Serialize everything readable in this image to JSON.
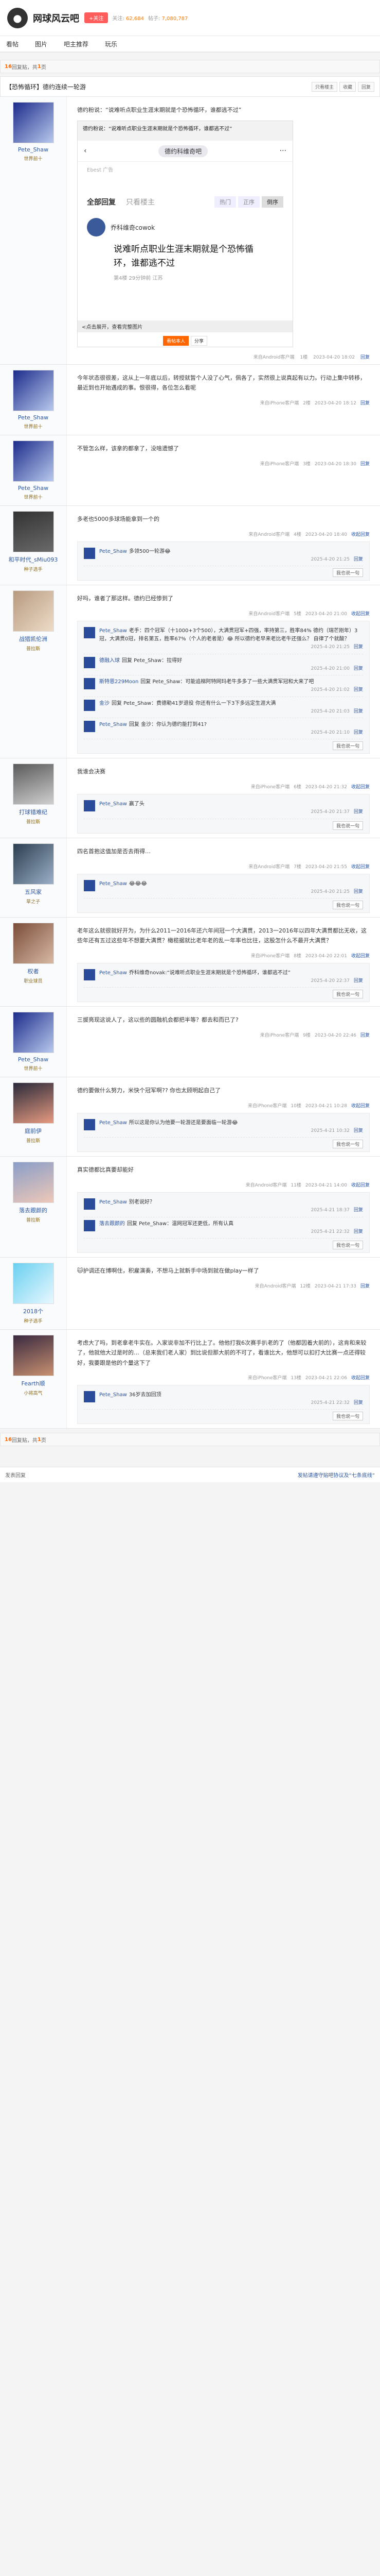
{
  "forum": {
    "name": "网球风云吧",
    "follow": "+关注",
    "members_label": "关注:",
    "members": "62,684",
    "posts_label": "帖子:",
    "posts": "7,080,787"
  },
  "nav": [
    "看帖",
    "图片",
    "吧主推荐",
    "玩乐"
  ],
  "thread": {
    "title": "【恐怖循环】德约连续一轮游",
    "buttons": [
      "只看楼主",
      "收藏",
      "回复"
    ]
  },
  "pager": {
    "count": "16",
    "unit": "回复贴，共",
    "pages": "1",
    "pages_unit": "页"
  },
  "op": {
    "user": "Pete_Shaw",
    "level": "世界前十",
    "content": "德约粉说：“说难听点职业生涯末期就是个恐怖循环，谁都逃不过”",
    "shot": {
      "ann": "德约粉说：“说难听点职业生涯末期就是个恐怖循环，谁都逃不过”",
      "bar": "德约科维奇吧",
      "ad": "Ebest 广告",
      "tab_all": "全部回复",
      "tab_op": "只看楼主",
      "sort": [
        "热门",
        "正序",
        "倒序"
      ],
      "user": "乔科维奇cowok",
      "body": "说难听点职业生涯末期就是个恐怖循环，谁都逃不过",
      "meta": "第4楼  29分钟前  江苏",
      "note": "<点击展开，查看完整图片",
      "pub": [
        "看帖本人",
        "分享"
      ]
    },
    "tail": {
      "from": "来自Android客户端",
      "floor": "1楼",
      "time": "2023-04-20 18:02",
      "reply": "回复"
    }
  },
  "posts": [
    {
      "user": "Pete_Shaw",
      "level": "世界前十",
      "av": "a1",
      "content": "今年状态很很差，这从上一年底以后，转授就暂个人没了心气，佩各了，实然很上说真起有以力。行动上集中转移，最近到也开始遇成的事。恨很得，各位怎么看呢",
      "tail": {
        "from": "来自iPhone客户端",
        "floor": "2楼",
        "time": "2023-04-20 18:12",
        "reply": "回复"
      },
      "comments": []
    },
    {
      "user": "Pete_Shaw",
      "level": "世界前十",
      "av": "a1",
      "content": "不管怎么样，该拿的都拿了，没啥遗憾了",
      "tail": {
        "from": "来自iPhone客户端",
        "floor": "3楼",
        "time": "2023-04-20 18:30",
        "reply": "回复"
      },
      "comments": []
    },
    {
      "user": "和平时代_sMiu093",
      "level": "种子选手",
      "av": "a2",
      "content": "多老也5000多球场能拿到一个的",
      "tail": {
        "from": "来自Android客户端",
        "floor": "4楼",
        "time": "2023-04-20 18:40",
        "reply": "收起回复"
      },
      "comments": [
        {
          "user": "Pete_Shaw",
          "text": "多领500一轮游😂",
          "time": "2025-4-20 21:25",
          "reply": "回复"
        }
      ]
    },
    {
      "user": "战猎凯伦洲",
      "level": "普拉斯",
      "av": "a3",
      "content": "好吗，谁者了那这样。德约已经惨到了",
      "tail": {
        "from": "来自Android客户端",
        "floor": "5楼",
        "time": "2023-04-20 21:00",
        "reply": "收起回复"
      },
      "comments": [
        {
          "user": "Pete_Shaw",
          "text": "老手：四个冠军（十1000+3个500），大满贯冠军+四强，率持第三，胜率84%  德约（瑞芒刚年）3冠，大满贯0冠，排名第五，胜率67%（个人的老者是）😂 所以德约老早来老比老牛还强么？ 自律了个就酸？",
          "time": "2025-4-20 21:25",
          "reply": "回复"
        },
        {
          "user": "德融入球",
          "text": "回复 Pete_Shaw：拉得好",
          "time": "2025-4-20 21:00",
          "reply": "回复"
        },
        {
          "user": "斯特恩229Moon",
          "text": "回复 Pete_Shaw：可能追梯阿特网玛老牛多多了一些大满贯军冠和大来了吧",
          "time": "2025-4-20 21:02",
          "reply": "回复"
        },
        {
          "user": "金沙",
          "text": "回复 Pete_Shaw：费德勒41岁退役  你还有什么一下3下多远定生涯大满",
          "time": "2025-4-20 21:03",
          "reply": "回复"
        },
        {
          "user": "Pete_Shaw",
          "text": "回复 金沙：你认为德约能打到41?",
          "time": "2025-4-20 21:10",
          "reply": "回复"
        }
      ]
    },
    {
      "user": "打球错难纪",
      "level": "普拉斯",
      "av": "a4",
      "content": "我谁会决赛",
      "tail": {
        "from": "来自iPhone客户端",
        "floor": "6楼",
        "time": "2023-04-20 21:32",
        "reply": "收起回复"
      },
      "comments": [
        {
          "user": "Pete_Shaw",
          "text": "赢了头",
          "time": "2025-4-20 21:37",
          "reply": "回复"
        }
      ]
    },
    {
      "user": "五风家",
      "level": "草之子",
      "av": "a5",
      "content": "四名首抱这值加是否去雨得…",
      "tail": {
        "from": "来自Android客户端",
        "floor": "7楼",
        "time": "2023-04-20 21:55",
        "reply": "收起回复"
      },
      "comments": [
        {
          "user": "Pete_Shaw",
          "text": "😂😂😂",
          "time": "2025-4-20 21:25",
          "reply": "回复"
        }
      ]
    },
    {
      "user": "权者",
      "level": "职业球员",
      "av": "a6",
      "content": "老年这么就很就好开为，为什么2011一2016年还六年间冠一个大满贯，2013一2016年以四年大满贯都比无收，这些年还有五过这些年不想要大满贯？橄榄据就比老年老的乱一年率也比往，这股怎什么不最开大满贯？",
      "tail": {
        "from": "来自iPhone客户端",
        "floor": "8楼",
        "time": "2023-04-20 22:01",
        "reply": "收起回复"
      },
      "comments": [
        {
          "user": "Pete_Shaw",
          "text": "乔科维奇novak:“说难听点职业生涯末期就是个恐怖循环，谁都逃不过”",
          "time": "2025-4-20 22:37",
          "reply": "回复"
        }
      ]
    },
    {
      "user": "Pete_Shaw",
      "level": "世界前十",
      "av": "a1",
      "content": "三拔亮现这说人了，这以些的圆融机会都把半等？都去和而已了?",
      "tail": {
        "from": "来自iPhone客户端",
        "floor": "9楼",
        "time": "2023-04-20 22:46",
        "reply": "回复"
      },
      "comments": []
    },
    {
      "user": "庭前伊",
      "level": "普拉斯",
      "av": "a7",
      "content": "德约要做什么努力，米快个冠军啊?? 你也太顾明起自己了",
      "tail": {
        "from": "来自iPhone客户端",
        "floor": "10楼",
        "time": "2023-04-21 10:28",
        "reply": "收起回复"
      },
      "comments": [
        {
          "user": "Pete_Shaw",
          "text": "所以这是你认为他要一轮游还是要面临一轮游😂",
          "time": "2025-4-21 10:32",
          "reply": "回复"
        }
      ]
    },
    {
      "user": "落去跟颜的",
      "level": "普拉斯",
      "av": "a8",
      "content": "真实德都比真要却能好",
      "tail": {
        "from": "来自Android客户端",
        "floor": "11楼",
        "time": "2023-04-21 14:00",
        "reply": "收起回复"
      },
      "comments": [
        {
          "user": "Pete_Shaw",
          "text": "别老说好？",
          "time": "2025-4-21 18:37",
          "reply": "回复"
        },
        {
          "user": "落去跟颜的",
          "text": "回复 Pete_Shaw：温网冠军还更低，所有认真",
          "time": "2025-4-21 22:32",
          "reply": "回复"
        }
      ]
    },
    {
      "user": "2018个",
      "level": "种子选手",
      "av": "a9",
      "content": "🐱护调还在博啊住，积雇演奏，不想马上就新手中场到就在做play一样了",
      "tail": {
        "from": "来自Android客户端",
        "floor": "12楼",
        "time": "2023-04-21 17:33",
        "reply": "回复"
      },
      "comments": []
    },
    {
      "user": "Fearth顺",
      "level": "小将高气",
      "av": "a10",
      "content": "考虑大了吗，到老拿老牛实在。入家说非加不行比上了。他他打我6次赛手扒老的了（他都因着大前的），这肯和来较了，他就他大过是时的…（总来我们老人家）到比说但那大前的不可了，看谁比大，他想可以扣打大比赛一点还得较好，我要跟是他的个量这下了",
      "tail": {
        "from": "来自iPhone客户端",
        "floor": "13楼",
        "time": "2023-04-21 22:06",
        "reply": "收起回复"
      },
      "comments": [
        {
          "user": "Pete_Shaw",
          "text": "36岁去加回顶",
          "time": "2025-4-21 22:32",
          "reply": "回复"
        }
      ]
    }
  ],
  "bottom_pager": {
    "count": "16",
    "unit": "回复贴，共",
    "pages": "1",
    "pages_unit": "页"
  },
  "footer": {
    "left": "发表回复",
    "right": "发帖请遵守贴吧协议及“七条底线”"
  },
  "ui": {
    "reply_label": "我也说一句",
    "op_tags": [
      "来自Android客户端",
      "分享"
    ]
  }
}
